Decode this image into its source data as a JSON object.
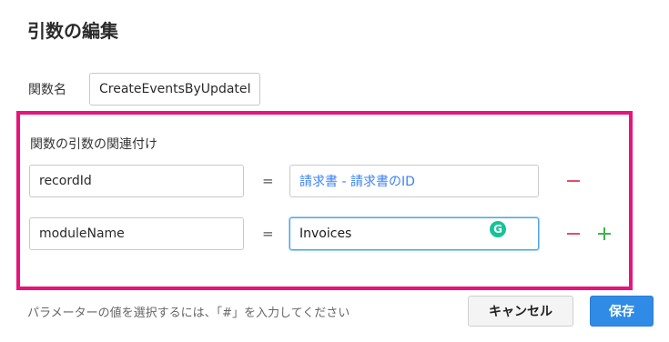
{
  "dialog": {
    "title": "引数の編集"
  },
  "function": {
    "label": "関数名",
    "value": "CreateEventsByUpdateIn"
  },
  "mapping": {
    "title": "関数の引数の関連付け",
    "rows": [
      {
        "argument": "recordId",
        "equals": "=",
        "value": "請求書 - 請求書のID"
      },
      {
        "argument": "moduleName",
        "equals": "=",
        "value": "Invoices"
      }
    ],
    "grammarly_icon": "G"
  },
  "footer": {
    "hint": "パラメーターの値を選択するには、「#」を入力してください",
    "cancel_label": "キャンセル",
    "save_label": "保存"
  },
  "colors": {
    "highlight_border": "#e8137b",
    "link_value": "#3b82f6",
    "save_button": "#2f8be6",
    "remove_icon": "#e0506a",
    "add_icon": "#3fb24f"
  },
  "icons": {
    "remove_row": "minus-icon",
    "add_row": "plus-icon",
    "grammarly": "grammarly-icon"
  }
}
